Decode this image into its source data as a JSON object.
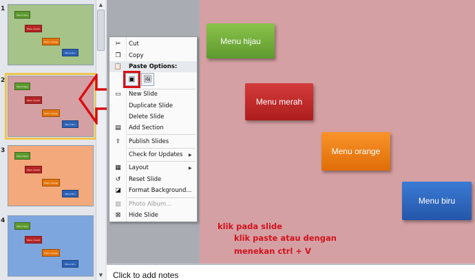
{
  "thumbnails": [
    {
      "number": "1",
      "bg": "#a6c389",
      "labels": {
        "hijau": "Menu hijau",
        "merah": "Menu merah",
        "orange": "Menu orange",
        "biru": "Menu biru"
      }
    },
    {
      "number": "2",
      "bg": "#d5a0a3",
      "labels": {
        "hijau": "Menu hijau",
        "merah": "Menu merah",
        "orange": "Menu orange",
        "biru": "Menu biru"
      }
    },
    {
      "number": "3",
      "bg": "#f3a97b",
      "labels": {
        "hijau": "Menu hijau",
        "merah": "Menu merah",
        "orange": "Menu orange",
        "biru": "Menu biru"
      }
    },
    {
      "number": "4",
      "bg": "#7ea6de",
      "labels": {
        "hijau": "Menu hijau",
        "merah": "Menu merah",
        "orange": "Menu orange",
        "biru": "Menu biru"
      }
    }
  ],
  "slide": {
    "bg": "#d5a0a3",
    "buttons": {
      "hijau": "Menu hijau",
      "merah": "Menu merah",
      "orange": "Menu orange",
      "biru": "Menu biru"
    },
    "annotation": {
      "line1": "klik pada slide",
      "line2": "klik paste atau dengan",
      "line3": "menekan ctrl + V"
    }
  },
  "context_menu": {
    "cut": "Cut",
    "copy": "Copy",
    "paste_options": "Paste Options:",
    "new_slide": "New Slide",
    "duplicate_slide": "Duplicate Slide",
    "delete_slide": "Delete Slide",
    "add_section": "Add Section",
    "publish_slides": "Publish Slides",
    "check_for_updates": "Check for Updates",
    "layout": "Layout",
    "reset_slide": "Reset Slide",
    "format_background": "Format Background...",
    "photo_album": "Photo Album...",
    "hide_slide": "Hide Slide"
  },
  "notes": {
    "placeholder": "Click to add notes"
  },
  "colors": {
    "highlight": "#d80e13",
    "selection": "#f0c44a"
  }
}
